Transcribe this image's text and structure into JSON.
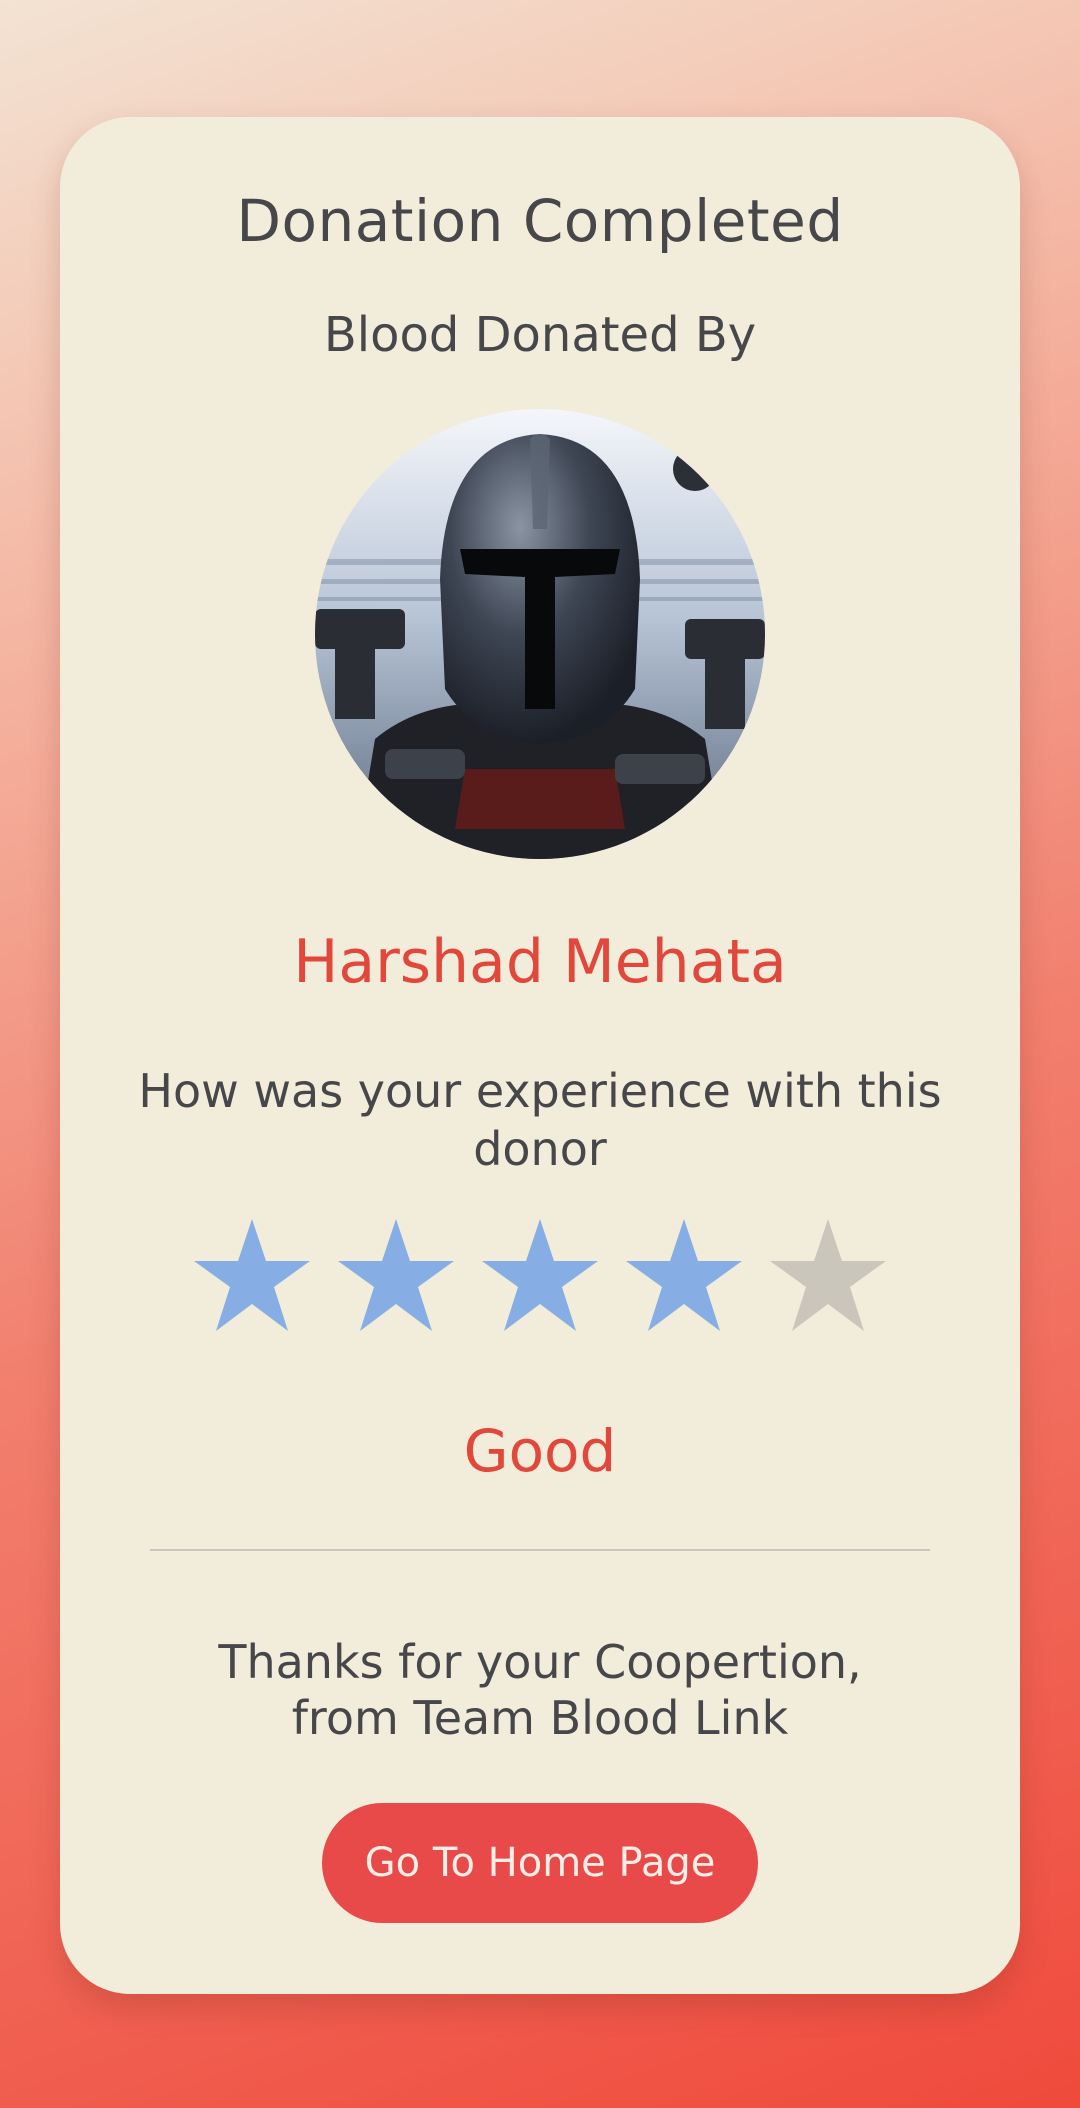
{
  "card": {
    "title": "Donation Completed",
    "subtitle": "Blood Donated By",
    "donor": {
      "name": "Harshad Mehata",
      "avatar_icon": "donor-avatar-photo"
    },
    "question": "How was your experience with this donor",
    "rating": {
      "value": 4,
      "max": 5,
      "label": "Good",
      "filled_color": "#86ade4",
      "empty_color": "#cbc6bb"
    },
    "thanks_line1": "Thanks for your Coopertion,",
    "thanks_line2": "from Team Blood Link",
    "home_button_label": "Go To Home Page"
  },
  "colors": {
    "accent": "#e2473b",
    "button": "#e84949",
    "card": "#f2eddb",
    "text": "#47474b"
  }
}
